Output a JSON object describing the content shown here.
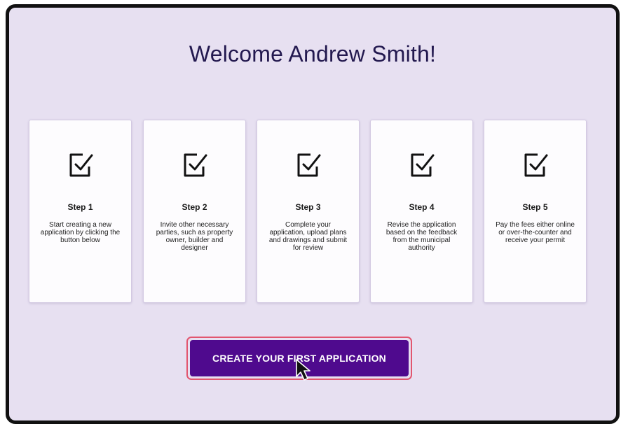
{
  "header": {
    "title": "Welcome Andrew Smith!"
  },
  "steps": [
    {
      "title": "Step 1",
      "description": "Start creating a new application by clicking the button below",
      "icon": "checklist-icon"
    },
    {
      "title": "Step 2",
      "description": "Invite other necessary parties, such as property owner, builder and designer",
      "icon": "checklist-icon"
    },
    {
      "title": "Step 3",
      "description": "Complete your application, upload plans and drawings and submit for review",
      "icon": "checklist-icon"
    },
    {
      "title": "Step 4",
      "description": "Revise the application based on the feedback from the municipal authority",
      "icon": "checklist-icon"
    },
    {
      "title": "Step 5",
      "description": "Pay the fees either online or over-the-counter and receive your permit",
      "icon": "checklist-icon"
    }
  ],
  "cta": {
    "label": "CREATE YOUR FIRST APPLICATION"
  },
  "colors": {
    "page_background": "#e7e0f1",
    "title_text": "#23194f",
    "button_background": "#4f0a8e",
    "button_focus_ring": "#e2566f",
    "card_background": "#fdfcfe"
  }
}
